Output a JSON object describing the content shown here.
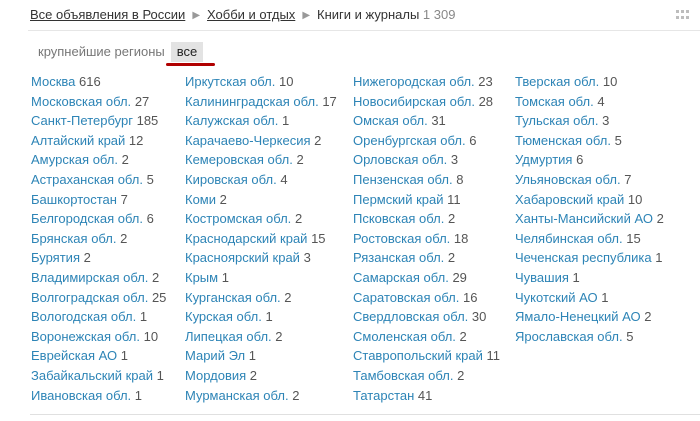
{
  "breadcrumbs": [
    {
      "label": "Все объявления в России"
    },
    {
      "label": "Хобби и отдых"
    },
    {
      "label": "Книги и журналы",
      "count": "1 309"
    }
  ],
  "filters": {
    "biggest": "крупнейшие регионы",
    "all": "все"
  },
  "columns": [
    [
      {
        "name": "Москва",
        "count": "616"
      },
      {
        "name": "Московская обл.",
        "count": "27"
      },
      {
        "name": "Санкт-Петербург",
        "count": "185"
      },
      {
        "name": "Алтайский край",
        "count": "12"
      },
      {
        "name": "Амурская обл.",
        "count": "2"
      },
      {
        "name": "Астраханская обл.",
        "count": "5"
      },
      {
        "name": "Башкортостан",
        "count": "7"
      },
      {
        "name": "Белгородская обл.",
        "count": "6"
      },
      {
        "name": "Брянская обл.",
        "count": "2"
      },
      {
        "name": "Бурятия",
        "count": "2"
      },
      {
        "name": "Владимирская обл.",
        "count": "2"
      },
      {
        "name": "Волгоградская обл.",
        "count": "25"
      },
      {
        "name": "Вологодская обл.",
        "count": "1"
      },
      {
        "name": "Воронежская обл.",
        "count": "10"
      },
      {
        "name": "Еврейская АО",
        "count": "1"
      },
      {
        "name": "Забайкальский край",
        "count": "1"
      },
      {
        "name": "Ивановская обл.",
        "count": "1"
      }
    ],
    [
      {
        "name": "Иркутская обл.",
        "count": "10"
      },
      {
        "name": "Калининградская обл.",
        "count": "17"
      },
      {
        "name": "Калужская обл.",
        "count": "1"
      },
      {
        "name": "Карачаево-Черкесия",
        "count": "2"
      },
      {
        "name": "Кемеровская обл.",
        "count": "2"
      },
      {
        "name": "Кировская обл.",
        "count": "4"
      },
      {
        "name": "Коми",
        "count": "2"
      },
      {
        "name": "Костромская обл.",
        "count": "2"
      },
      {
        "name": "Краснодарский край",
        "count": "15"
      },
      {
        "name": "Красноярский край",
        "count": "3"
      },
      {
        "name": "Крым",
        "count": "1"
      },
      {
        "name": "Курганская обл.",
        "count": "2"
      },
      {
        "name": "Курская обл.",
        "count": "1"
      },
      {
        "name": "Липецкая обл.",
        "count": "2"
      },
      {
        "name": "Марий Эл",
        "count": "1"
      },
      {
        "name": "Мордовия",
        "count": "2"
      },
      {
        "name": "Мурманская обл.",
        "count": "2"
      }
    ],
    [
      {
        "name": "Нижегородская обл.",
        "count": "23"
      },
      {
        "name": "Новосибирская обл.",
        "count": "28"
      },
      {
        "name": "Омская обл.",
        "count": "31"
      },
      {
        "name": "Оренбургская обл.",
        "count": "6"
      },
      {
        "name": "Орловская обл.",
        "count": "3"
      },
      {
        "name": "Пензенская обл.",
        "count": "8"
      },
      {
        "name": "Пермский край",
        "count": "11"
      },
      {
        "name": "Псковская обл.",
        "count": "2"
      },
      {
        "name": "Ростовская обл.",
        "count": "18"
      },
      {
        "name": "Рязанская обл.",
        "count": "2"
      },
      {
        "name": "Самарская обл.",
        "count": "29"
      },
      {
        "name": "Саратовская обл.",
        "count": "16"
      },
      {
        "name": "Свердловская обл.",
        "count": "30"
      },
      {
        "name": "Смоленская обл.",
        "count": "2"
      },
      {
        "name": "Ставропольский край",
        "count": "11"
      },
      {
        "name": "Тамбовская обл.",
        "count": "2"
      },
      {
        "name": "Татарстан",
        "count": "41"
      }
    ],
    [
      {
        "name": "Тверская обл.",
        "count": "10"
      },
      {
        "name": "Томская обл.",
        "count": "4"
      },
      {
        "name": "Тульская обл.",
        "count": "3"
      },
      {
        "name": "Тюменская обл.",
        "count": "5"
      },
      {
        "name": "Удмуртия",
        "count": "6"
      },
      {
        "name": "Ульяновская обл.",
        "count": "7"
      },
      {
        "name": "Хабаровский край",
        "count": "10"
      },
      {
        "name": "Ханты-Мансийский АО",
        "count": "2"
      },
      {
        "name": "Челябинская обл.",
        "count": "15"
      },
      {
        "name": "Чеченская республика",
        "count": "1"
      },
      {
        "name": "Чувашия",
        "count": "1"
      },
      {
        "name": "Чукотский АО",
        "count": "1"
      },
      {
        "name": "Ямало-Ненецкий АО",
        "count": "2"
      },
      {
        "name": "Ярославская обл.",
        "count": "5"
      }
    ]
  ]
}
